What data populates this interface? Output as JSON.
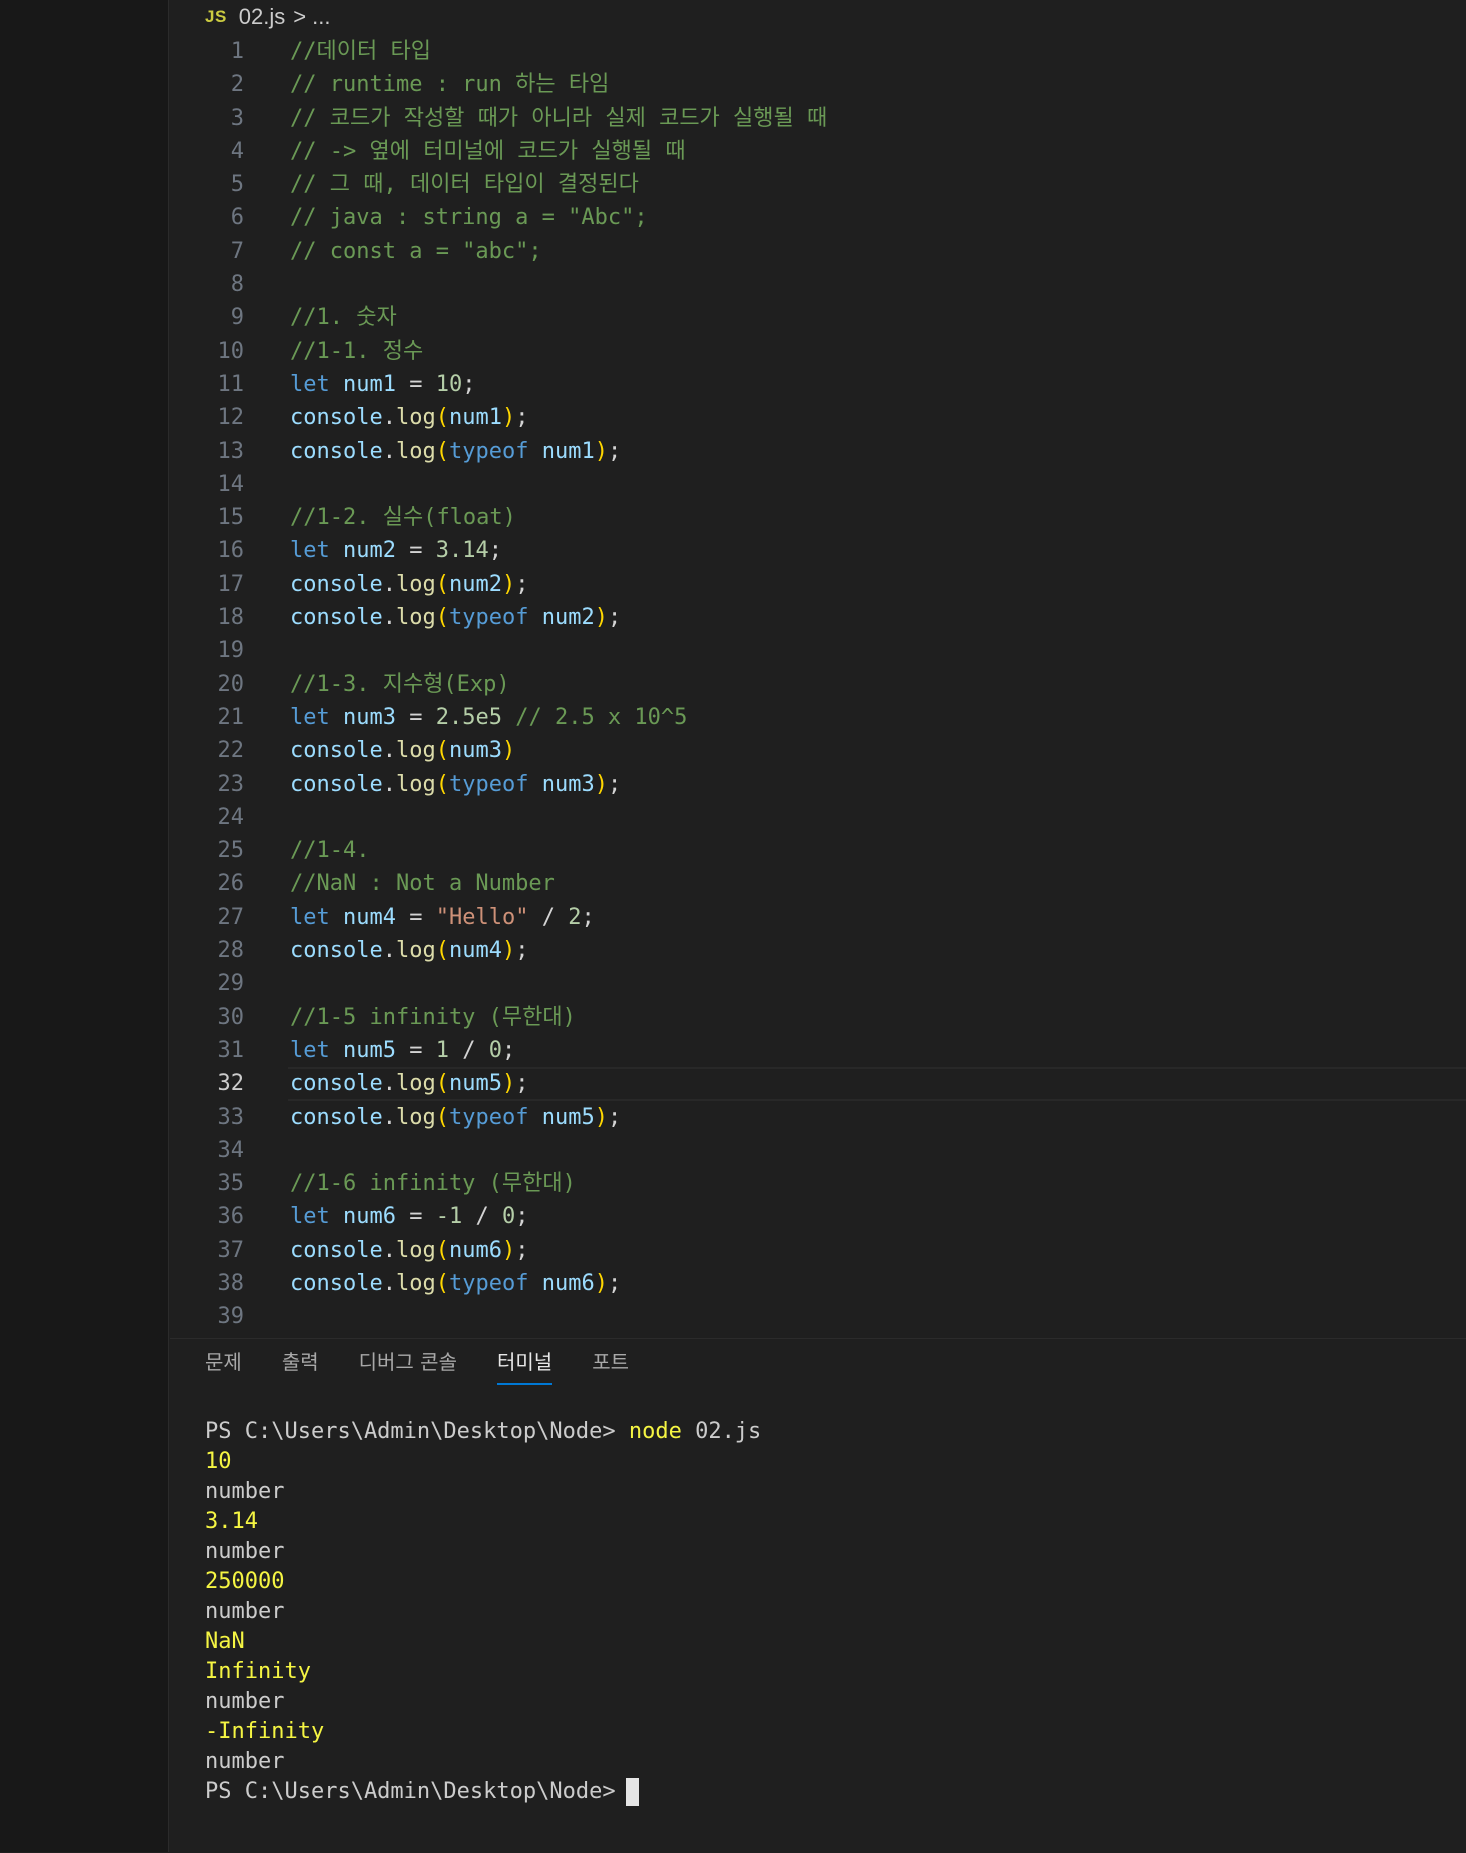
{
  "breadcrumb": {
    "file_icon": "JS",
    "file_name": "02.js",
    "separator": ">",
    "more": "..."
  },
  "editor": {
    "current_line": 32,
    "lines": [
      {
        "n": "1",
        "tokens": [
          {
            "t": "//데이터 타입",
            "c": "com"
          }
        ]
      },
      {
        "n": "2",
        "tokens": [
          {
            "t": "// runtime : run 하는 타임",
            "c": "com"
          }
        ]
      },
      {
        "n": "3",
        "tokens": [
          {
            "t": "// 코드가 작성할 때가 아니라 실제 코드가 실행될 때",
            "c": "com"
          }
        ]
      },
      {
        "n": "4",
        "tokens": [
          {
            "t": "// -> 옆에 터미널에 코드가 실행될 때",
            "c": "com"
          }
        ]
      },
      {
        "n": "5",
        "tokens": [
          {
            "t": "// 그 때, 데이터 타입이 결정된다",
            "c": "com"
          }
        ]
      },
      {
        "n": "6",
        "tokens": [
          {
            "t": "// java : string a = \"Abc\";",
            "c": "com"
          }
        ]
      },
      {
        "n": "7",
        "tokens": [
          {
            "t": "// const a = \"abc\";",
            "c": "com"
          }
        ]
      },
      {
        "n": "8",
        "tokens": []
      },
      {
        "n": "9",
        "tokens": [
          {
            "t": "//1. 숫자",
            "c": "com"
          }
        ]
      },
      {
        "n": "10",
        "tokens": [
          {
            "t": "//1-1. 정수",
            "c": "com"
          }
        ]
      },
      {
        "n": "11",
        "tokens": [
          {
            "t": "let",
            "c": "kw"
          },
          {
            "t": " ",
            "c": "pun"
          },
          {
            "t": "num1",
            "c": "var"
          },
          {
            "t": " = ",
            "c": "pun"
          },
          {
            "t": "10",
            "c": "num"
          },
          {
            "t": ";",
            "c": "pun"
          }
        ]
      },
      {
        "n": "12",
        "tokens": [
          {
            "t": "console",
            "c": "var"
          },
          {
            "t": ".",
            "c": "pun"
          },
          {
            "t": "log",
            "c": "fn"
          },
          {
            "t": "(",
            "c": "br1"
          },
          {
            "t": "num1",
            "c": "var"
          },
          {
            "t": ")",
            "c": "br1"
          },
          {
            "t": ";",
            "c": "pun"
          }
        ]
      },
      {
        "n": "13",
        "tokens": [
          {
            "t": "console",
            "c": "var"
          },
          {
            "t": ".",
            "c": "pun"
          },
          {
            "t": "log",
            "c": "fn"
          },
          {
            "t": "(",
            "c": "br1"
          },
          {
            "t": "typeof",
            "c": "kw"
          },
          {
            "t": " ",
            "c": "pun"
          },
          {
            "t": "num1",
            "c": "var"
          },
          {
            "t": ")",
            "c": "br1"
          },
          {
            "t": ";",
            "c": "pun"
          }
        ]
      },
      {
        "n": "14",
        "tokens": []
      },
      {
        "n": "15",
        "tokens": [
          {
            "t": "//1-2. 실수(float)",
            "c": "com"
          }
        ]
      },
      {
        "n": "16",
        "tokens": [
          {
            "t": "let",
            "c": "kw"
          },
          {
            "t": " ",
            "c": "pun"
          },
          {
            "t": "num2",
            "c": "var"
          },
          {
            "t": " = ",
            "c": "pun"
          },
          {
            "t": "3.14",
            "c": "num"
          },
          {
            "t": ";",
            "c": "pun"
          }
        ]
      },
      {
        "n": "17",
        "tokens": [
          {
            "t": "console",
            "c": "var"
          },
          {
            "t": ".",
            "c": "pun"
          },
          {
            "t": "log",
            "c": "fn"
          },
          {
            "t": "(",
            "c": "br1"
          },
          {
            "t": "num2",
            "c": "var"
          },
          {
            "t": ")",
            "c": "br1"
          },
          {
            "t": ";",
            "c": "pun"
          }
        ]
      },
      {
        "n": "18",
        "tokens": [
          {
            "t": "console",
            "c": "var"
          },
          {
            "t": ".",
            "c": "pun"
          },
          {
            "t": "log",
            "c": "fn"
          },
          {
            "t": "(",
            "c": "br1"
          },
          {
            "t": "typeof",
            "c": "kw"
          },
          {
            "t": " ",
            "c": "pun"
          },
          {
            "t": "num2",
            "c": "var"
          },
          {
            "t": ")",
            "c": "br1"
          },
          {
            "t": ";",
            "c": "pun"
          }
        ]
      },
      {
        "n": "19",
        "tokens": []
      },
      {
        "n": "20",
        "tokens": [
          {
            "t": "//1-3. 지수형(Exp)",
            "c": "com"
          }
        ]
      },
      {
        "n": "21",
        "tokens": [
          {
            "t": "let",
            "c": "kw"
          },
          {
            "t": " ",
            "c": "pun"
          },
          {
            "t": "num3",
            "c": "var"
          },
          {
            "t": " = ",
            "c": "pun"
          },
          {
            "t": "2.5e5",
            "c": "num"
          },
          {
            "t": " ",
            "c": "pun"
          },
          {
            "t": "// 2.5 x 10^5",
            "c": "com"
          }
        ]
      },
      {
        "n": "22",
        "tokens": [
          {
            "t": "console",
            "c": "var"
          },
          {
            "t": ".",
            "c": "pun"
          },
          {
            "t": "log",
            "c": "fn"
          },
          {
            "t": "(",
            "c": "br1"
          },
          {
            "t": "num3",
            "c": "var"
          },
          {
            "t": ")",
            "c": "br1"
          }
        ]
      },
      {
        "n": "23",
        "tokens": [
          {
            "t": "console",
            "c": "var"
          },
          {
            "t": ".",
            "c": "pun"
          },
          {
            "t": "log",
            "c": "fn"
          },
          {
            "t": "(",
            "c": "br1"
          },
          {
            "t": "typeof",
            "c": "kw"
          },
          {
            "t": " ",
            "c": "pun"
          },
          {
            "t": "num3",
            "c": "var"
          },
          {
            "t": ")",
            "c": "br1"
          },
          {
            "t": ";",
            "c": "pun"
          }
        ]
      },
      {
        "n": "24",
        "tokens": []
      },
      {
        "n": "25",
        "tokens": [
          {
            "t": "//1-4.",
            "c": "com"
          }
        ]
      },
      {
        "n": "26",
        "tokens": [
          {
            "t": "//NaN : Not a Number",
            "c": "com"
          }
        ]
      },
      {
        "n": "27",
        "tokens": [
          {
            "t": "let",
            "c": "kw"
          },
          {
            "t": " ",
            "c": "pun"
          },
          {
            "t": "num4",
            "c": "var"
          },
          {
            "t": " = ",
            "c": "pun"
          },
          {
            "t": "\"Hello\"",
            "c": "str"
          },
          {
            "t": " / ",
            "c": "pun"
          },
          {
            "t": "2",
            "c": "num"
          },
          {
            "t": ";",
            "c": "pun"
          }
        ]
      },
      {
        "n": "28",
        "tokens": [
          {
            "t": "console",
            "c": "var"
          },
          {
            "t": ".",
            "c": "pun"
          },
          {
            "t": "log",
            "c": "fn"
          },
          {
            "t": "(",
            "c": "br1"
          },
          {
            "t": "num4",
            "c": "var"
          },
          {
            "t": ")",
            "c": "br1"
          },
          {
            "t": ";",
            "c": "pun"
          }
        ]
      },
      {
        "n": "29",
        "tokens": []
      },
      {
        "n": "30",
        "tokens": [
          {
            "t": "//1-5 infinity (무한대)",
            "c": "com"
          }
        ]
      },
      {
        "n": "31",
        "tokens": [
          {
            "t": "let",
            "c": "kw"
          },
          {
            "t": " ",
            "c": "pun"
          },
          {
            "t": "num5",
            "c": "var"
          },
          {
            "t": " = ",
            "c": "pun"
          },
          {
            "t": "1",
            "c": "num"
          },
          {
            "t": " / ",
            "c": "pun"
          },
          {
            "t": "0",
            "c": "num"
          },
          {
            "t": ";",
            "c": "pun"
          }
        ]
      },
      {
        "n": "32",
        "tokens": [
          {
            "t": "console",
            "c": "var"
          },
          {
            "t": ".",
            "c": "pun"
          },
          {
            "t": "log",
            "c": "fn"
          },
          {
            "t": "(",
            "c": "br1"
          },
          {
            "t": "num5",
            "c": "var"
          },
          {
            "t": ")",
            "c": "br1"
          },
          {
            "t": ";",
            "c": "pun"
          }
        ]
      },
      {
        "n": "33",
        "tokens": [
          {
            "t": "console",
            "c": "var"
          },
          {
            "t": ".",
            "c": "pun"
          },
          {
            "t": "log",
            "c": "fn"
          },
          {
            "t": "(",
            "c": "br1"
          },
          {
            "t": "typeof",
            "c": "kw"
          },
          {
            "t": " ",
            "c": "pun"
          },
          {
            "t": "num5",
            "c": "var"
          },
          {
            "t": ")",
            "c": "br1"
          },
          {
            "t": ";",
            "c": "pun"
          }
        ]
      },
      {
        "n": "34",
        "tokens": []
      },
      {
        "n": "35",
        "tokens": [
          {
            "t": "//1-6 infinity (무한대)",
            "c": "com"
          }
        ]
      },
      {
        "n": "36",
        "tokens": [
          {
            "t": "let",
            "c": "kw"
          },
          {
            "t": " ",
            "c": "pun"
          },
          {
            "t": "num6",
            "c": "var"
          },
          {
            "t": " = ",
            "c": "pun"
          },
          {
            "t": "-1",
            "c": "num"
          },
          {
            "t": " / ",
            "c": "pun"
          },
          {
            "t": "0",
            "c": "num"
          },
          {
            "t": ";",
            "c": "pun"
          }
        ]
      },
      {
        "n": "37",
        "tokens": [
          {
            "t": "console",
            "c": "var"
          },
          {
            "t": ".",
            "c": "pun"
          },
          {
            "t": "log",
            "c": "fn"
          },
          {
            "t": "(",
            "c": "br1"
          },
          {
            "t": "num6",
            "c": "var"
          },
          {
            "t": ")",
            "c": "br1"
          },
          {
            "t": ";",
            "c": "pun"
          }
        ]
      },
      {
        "n": "38",
        "tokens": [
          {
            "t": "console",
            "c": "var"
          },
          {
            "t": ".",
            "c": "pun"
          },
          {
            "t": "log",
            "c": "fn"
          },
          {
            "t": "(",
            "c": "br1"
          },
          {
            "t": "typeof",
            "c": "kw"
          },
          {
            "t": " ",
            "c": "pun"
          },
          {
            "t": "num6",
            "c": "var"
          },
          {
            "t": ")",
            "c": "br1"
          },
          {
            "t": ";",
            "c": "pun"
          }
        ]
      },
      {
        "n": "39",
        "tokens": []
      }
    ]
  },
  "panel": {
    "tabs": [
      {
        "label": "문제",
        "active": false
      },
      {
        "label": "출력",
        "active": false
      },
      {
        "label": "디버그 콘솔",
        "active": false
      },
      {
        "label": "터미널",
        "active": true
      },
      {
        "label": "포트",
        "active": false
      }
    ]
  },
  "terminal": {
    "prompt_line": {
      "prompt": "PS C:\\Users\\Admin\\Desktop\\Node> ",
      "command": "node",
      "args": " 02.js"
    },
    "output": [
      {
        "text": "10",
        "color": "yellow"
      },
      {
        "text": "number",
        "color": "default"
      },
      {
        "text": "3.14",
        "color": "yellow"
      },
      {
        "text": "number",
        "color": "default"
      },
      {
        "text": "250000",
        "color": "yellow"
      },
      {
        "text": "number",
        "color": "default"
      },
      {
        "text": "NaN",
        "color": "yellow"
      },
      {
        "text": "Infinity",
        "color": "yellow"
      },
      {
        "text": "number",
        "color": "default"
      },
      {
        "text": "-Infinity",
        "color": "yellow"
      },
      {
        "text": "number",
        "color": "default"
      }
    ],
    "final_prompt": "PS C:\\Users\\Admin\\Desktop\\Node>"
  },
  "colors": {
    "editor_bg": "#1f1f1f",
    "comment": "#6a9955",
    "keyword": "#569cd6",
    "variable": "#9cdcfe",
    "function": "#dcdcaa",
    "number": "#b5cea8",
    "string": "#ce9178",
    "bracket": "#ffd700",
    "terminal_yellow": "#f5f543",
    "tab_active_underline": "#0078d4"
  }
}
